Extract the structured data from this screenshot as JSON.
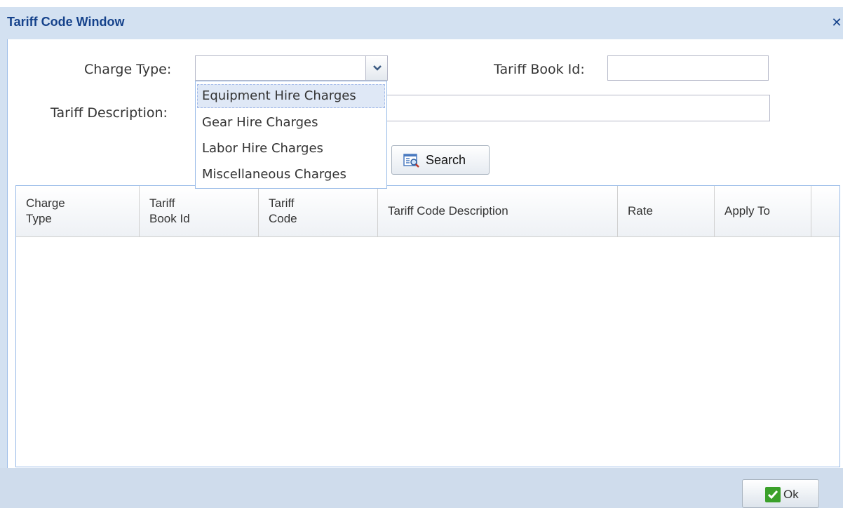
{
  "window": {
    "title": "Tariff Code Window",
    "close_label": "✕"
  },
  "form": {
    "charge_type_label": "Charge Type:",
    "charge_type_value": "",
    "tariff_book_id_label": "Tariff Book Id:",
    "tariff_book_id_value": "",
    "tariff_description_label": "Tariff Description:",
    "tariff_description_value": ""
  },
  "dropdown": {
    "options": [
      "Equipment Hire Charges",
      "Gear Hire Charges",
      "Labor Hire Charges",
      "Miscellaneous Charges"
    ],
    "highlighted_index": 0
  },
  "buttons": {
    "search_label": "Search",
    "ok_label": "Ok"
  },
  "grid": {
    "columns": [
      "Charge\nType",
      "Tariff\nBook Id",
      "Tariff\nCode",
      "Tariff Code Description",
      "Rate",
      "Apply To",
      ""
    ],
    "rows": []
  },
  "colors": {
    "title_text": "#15428b",
    "window_frame": "#d3e1f1",
    "accent_border": "#99bbe8",
    "ok_check": "#3aa02a"
  },
  "icons": {
    "close": "close-icon",
    "combo_trigger": "chevron-down-icon",
    "search": "search-icon",
    "ok": "check-icon"
  }
}
